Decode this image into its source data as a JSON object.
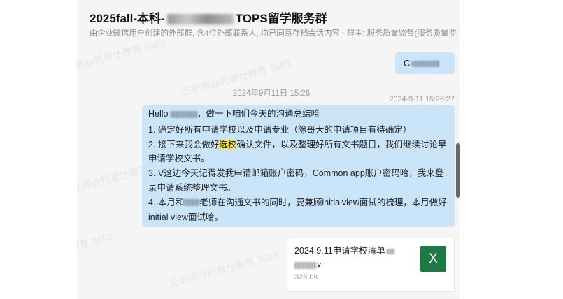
{
  "header": {
    "title_prefix": "2025fall-本科-",
    "title_suffix": "TOPS留学服务群",
    "subtitle": "由企业微信用户创建的外部群, 含4位外部联系人, 均已同意存档会话内容 · 群主: 服务质量监督(服务质量监"
  },
  "watermark": "王老师@托普仕教育 3683",
  "earlier_message": {
    "text_prefix": "C"
  },
  "date_divider": "2024年9月11日 15:26",
  "summary_message": {
    "timestamp": "2024-9-11 15:26:27",
    "greeting_prefix": "Hello ",
    "greeting_suffix": "，做一下咱们今天的沟通总结哈",
    "item1": "1. 确定好所有申请学校以及申请专业（除哥大的申请项目有待确定）",
    "item2_before": "2. 接下来我会做好",
    "item2_highlight": "选校",
    "item2_after": "确认文件，以及整理好所有文书题目，我们继续讨论早申请学校文书。",
    "item3": "3. V这边今天记得发我申请邮箱账户密码，Common app账户密码哈，我来登录申请系统整理文书。",
    "item4_before": "4. 本月和",
    "item4_after": "老师在沟通文书的同时，要兼顾initialview面试的梳理，本月做好initial view面试哈。"
  },
  "file_message": {
    "name_line1": "2024.9.11申请学校清单",
    "name_line2_suffix": "x",
    "size": "325.0K",
    "icon": "excel-file-icon",
    "icon_letter": "X"
  },
  "colors": {
    "panel_background": "#f5f5f5",
    "bubble": "#cae4fa",
    "highlight": "#fde74c",
    "excel_green": "#1e7a45"
  }
}
